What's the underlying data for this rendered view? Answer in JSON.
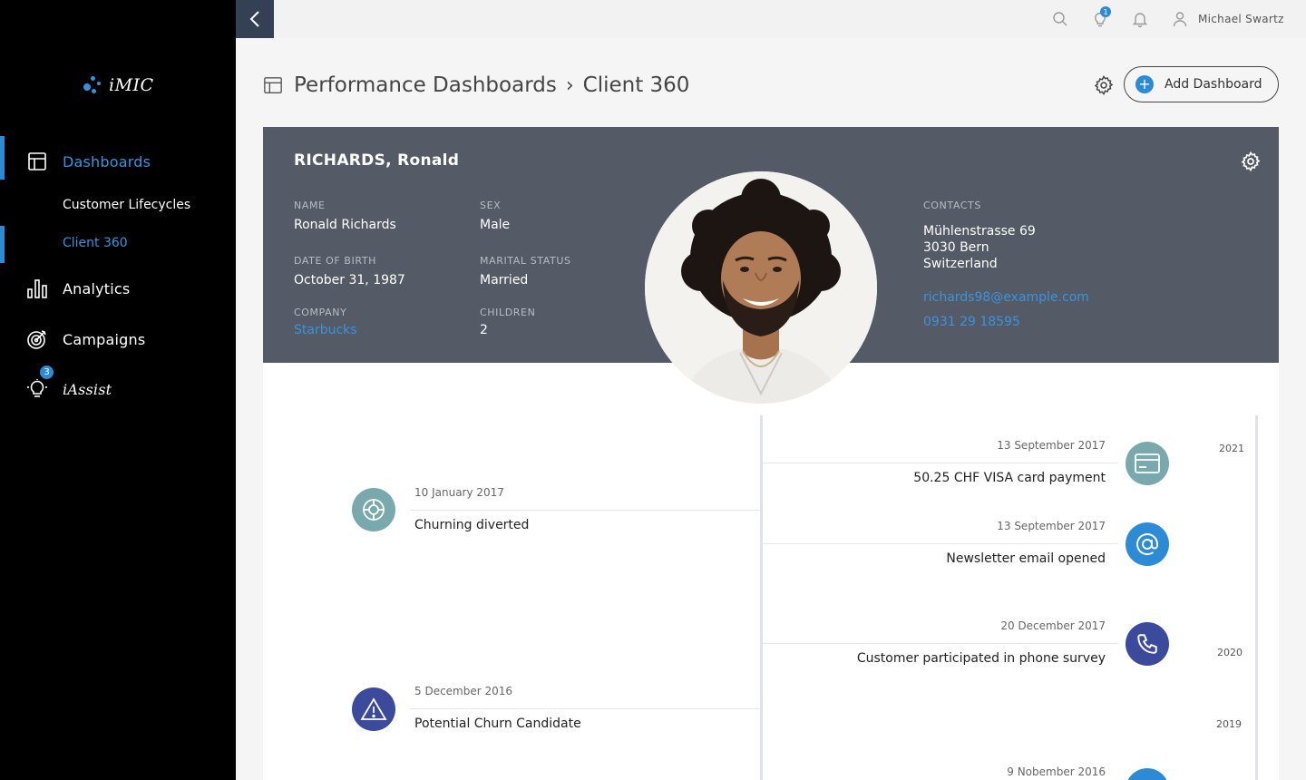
{
  "app": {
    "logo_text": "iMIC"
  },
  "sidebar": {
    "items": [
      {
        "label": "Dashboards",
        "icon": "dashboard-icon"
      },
      {
        "label": "Analytics",
        "icon": "bar-chart-icon"
      },
      {
        "label": "Campaigns",
        "icon": "target-icon"
      },
      {
        "label": "iAssist",
        "icon": "lightbulb-icon",
        "badge": "3"
      }
    ],
    "subitems": [
      {
        "label": "Customer Lifecycles"
      },
      {
        "label": "Client 360"
      }
    ]
  },
  "topbar": {
    "notification_badge": "1",
    "user_name": "Michael Swartz"
  },
  "header": {
    "crumb_root": "Performance Dashboards",
    "separator": "›",
    "crumb_current": "Client 360",
    "add_button": "Add Dashboard",
    "add_symbol": "+"
  },
  "client": {
    "title": "RICHARDS, Ronald",
    "labels": {
      "name": "NAME",
      "sex": "SEX",
      "dob": "DATE OF BIRTH",
      "marital": "MARITAL STATUS",
      "company": "COMPANY",
      "children": "CHILDREN",
      "contacts": "CONTACTS"
    },
    "name": "Ronald Richards",
    "sex": "Male",
    "dob": "October 31, 1987",
    "marital": "Married",
    "company": "Starbucks",
    "children": "2",
    "address_line1": "Mühlenstrasse 69",
    "address_line2": "3030 Bern",
    "address_line3": "Switzerland",
    "email": "richards98@example.com",
    "phone": "0931 29 18595"
  },
  "timeline": {
    "left_events": [
      {
        "date": "10 January 2017",
        "title": "Churning diverted",
        "icon": "lifebuoy-icon",
        "color": "#79a8ad"
      },
      {
        "date": "5 December 2016",
        "title": "Potential Churn Candidate",
        "icon": "warning-icon",
        "color": "#3b4a9a"
      }
    ],
    "right_events": [
      {
        "date": "13 September 2017",
        "title": "50.25 CHF VISA card payment",
        "icon": "credit-card-icon",
        "color": "#79a8ad"
      },
      {
        "date": "13 September 2017",
        "title": "Newsletter email opened",
        "icon": "at-sign-icon",
        "color": "#2d8ad4"
      },
      {
        "date": "20 December 2017",
        "title": "Customer participated in phone survey",
        "icon": "phone-icon",
        "color": "#3b4a9a"
      },
      {
        "date": "9 Nobember 2016",
        "title": "",
        "icon": "circle-icon",
        "color": "#2d8ad4"
      }
    ],
    "years": [
      "2021",
      "2020",
      "2019"
    ]
  },
  "colors": {
    "accent": "#2d8ad4",
    "sidebar_bg": "#000000",
    "card_head_bg": "#545b66"
  }
}
